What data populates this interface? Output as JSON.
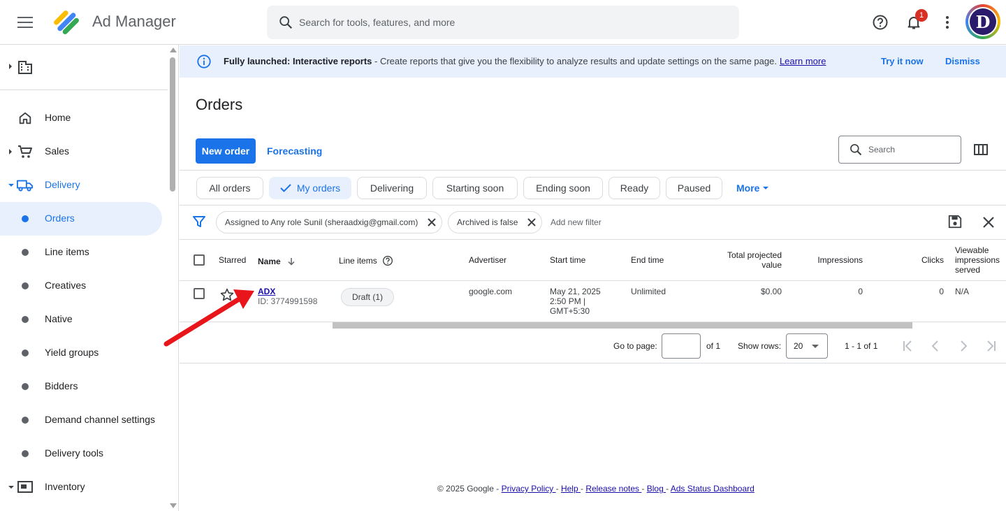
{
  "app": {
    "title": "Ad Manager"
  },
  "header": {
    "search_placeholder": "Search for tools, features, and more",
    "notification_count": "1",
    "avatar_letter": "D"
  },
  "sidebar": {
    "items": [
      {
        "label": "Home",
        "icon": "home-icon"
      },
      {
        "label": "Sales",
        "icon": "cart-icon"
      },
      {
        "label": "Delivery",
        "icon": "truck-icon"
      },
      {
        "label": "Orders"
      },
      {
        "label": "Line items"
      },
      {
        "label": "Creatives"
      },
      {
        "label": "Native"
      },
      {
        "label": "Yield groups"
      },
      {
        "label": "Bidders"
      },
      {
        "label": "Demand channel settings"
      },
      {
        "label": "Delivery tools"
      },
      {
        "label": "Inventory",
        "icon": "inventory-icon"
      }
    ]
  },
  "banner": {
    "bold": "Fully launched: Interactive reports",
    "text": " - Create reports that give you the flexibility to analyze results and update settings on the same page.",
    "learn_more": "Learn more",
    "try_it": "Try it now",
    "dismiss": "Dismiss"
  },
  "main": {
    "title": "Orders",
    "new_order": "New order",
    "forecasting": "Forecasting",
    "search_placeholder": "Search",
    "tabs": [
      "All orders",
      "My orders",
      "Delivering",
      "Starting soon",
      "Ending soon",
      "Ready",
      "Paused"
    ],
    "more": "More",
    "filters": [
      "Assigned to Any role Sunil (sheraadxig@gmail.com)",
      "Archived is false"
    ],
    "add_filter": "Add new filter"
  },
  "table": {
    "headers": {
      "starred": "Starred",
      "name": "Name",
      "line_items": "Line items",
      "advertiser": "Advertiser",
      "start_time": "Start time",
      "end_time": "End time",
      "total_projected_value_1": "Total projected",
      "total_projected_value_2": "value",
      "impressions": "Impressions",
      "clicks": "Clicks",
      "viewable_1": "Viewable",
      "viewable_2": "impressions",
      "viewable_3": "served"
    },
    "rows": [
      {
        "name": "ADX",
        "id": "ID: 3774991598",
        "line_items": "Draft (1)",
        "advertiser": "google.com",
        "start_1": "May 21, 2025",
        "start_2": "2:50 PM |",
        "start_3": "GMT+5:30",
        "end_time": "Unlimited",
        "total_value": "$0.00",
        "impressions": "0",
        "clicks": "0",
        "viewable": "N/A"
      }
    ]
  },
  "pager": {
    "go_to_page": "Go to page:",
    "of_pages": "of 1",
    "show_rows": "Show rows:",
    "rows_value": "20",
    "range": "1 - 1 of 1"
  },
  "footer": {
    "copyright": "© 2025 Google - ",
    "privacy": "Privacy Policy ",
    "help": "Help ",
    "release": "Release notes ",
    "blog": "Blog ",
    "status": "Ads Status Dashboard",
    "sep": "- "
  },
  "colors": {
    "accent": "#1a73e8",
    "badge": "#d93025",
    "annotation_arrow": "#e8161b"
  }
}
